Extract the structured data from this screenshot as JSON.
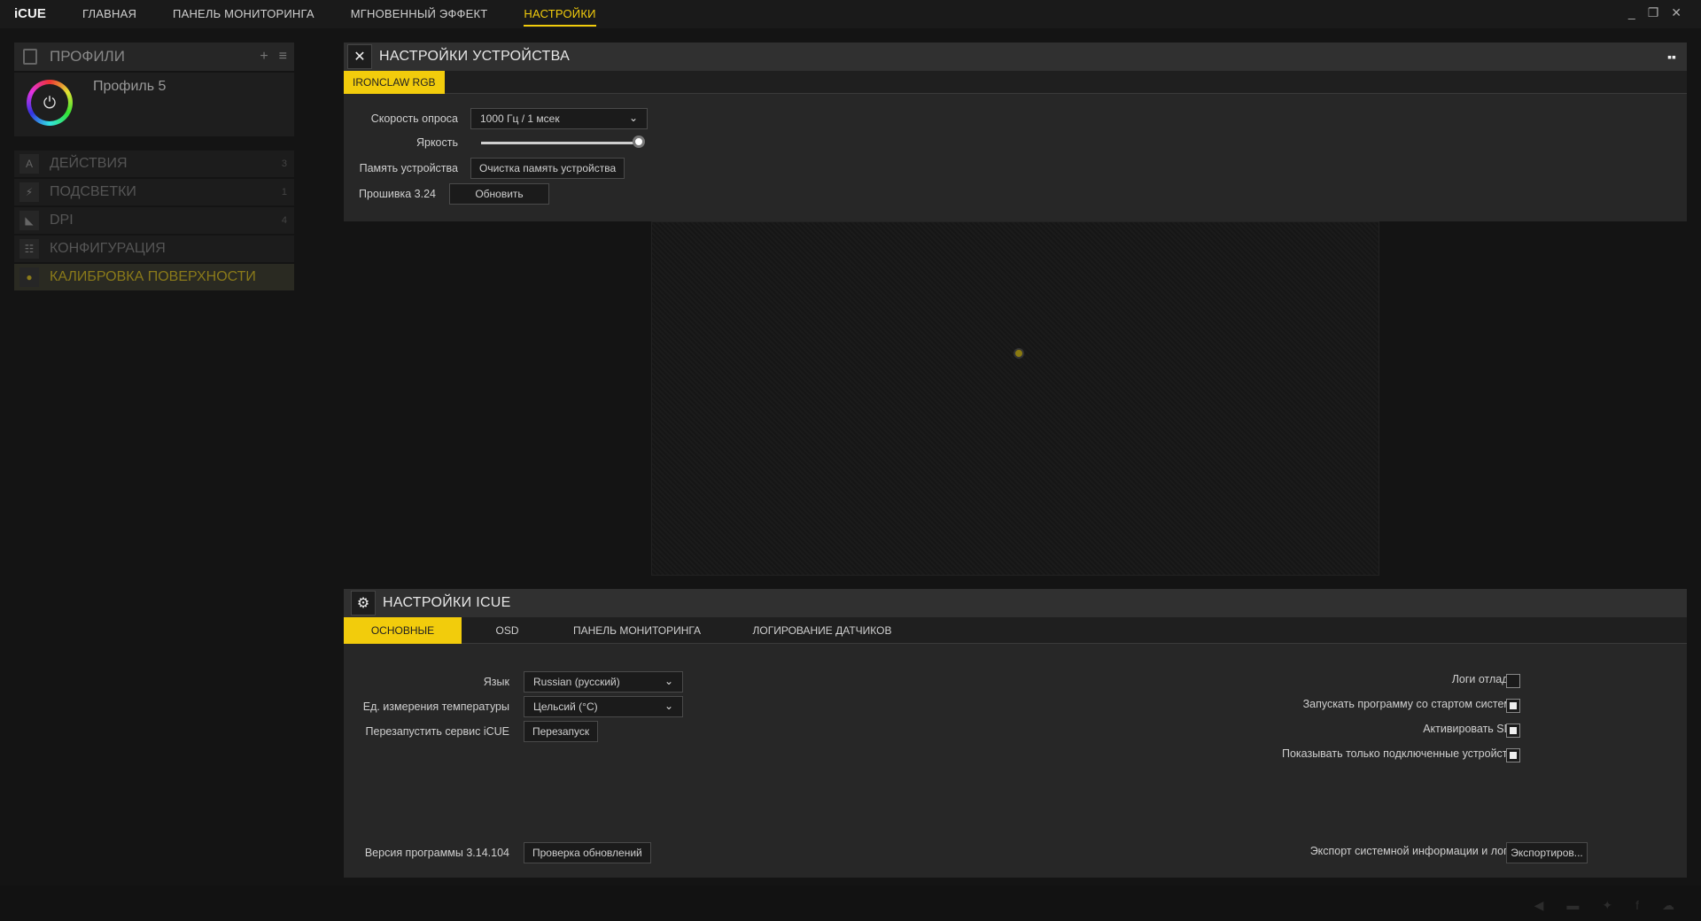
{
  "app": {
    "logo": "iCUE"
  },
  "nav": [
    "ГЛАВНАЯ",
    "ПАНЕЛЬ МОНИТОРИНГА",
    "МГНОВЕННЫЙ ЭФФЕКТ",
    "НАСТРОЙКИ"
  ],
  "sidebar": {
    "profiles_title": "ПРОФИЛИ",
    "profile_name": "Профиль 5",
    "items": [
      {
        "label": "ДЕЙСТВИЯ",
        "count": "3"
      },
      {
        "label": "ПОДСВЕТКИ",
        "count": "1"
      },
      {
        "label": "DPI",
        "count": "4"
      },
      {
        "label": "КОНФИГУРАЦИЯ",
        "count": ""
      },
      {
        "label": "КАЛИБРОВКА ПОВЕРХНОСТИ",
        "count": ""
      }
    ]
  },
  "device": {
    "title": "НАСТРОЙКИ УСТРОЙСТВА",
    "tab": "IRONCLAW RGB",
    "polling_label": "Скорость опроса",
    "polling_value": "1000 Гц / 1 мсек",
    "brightness_label": "Яркость",
    "brightness_level": 1.0,
    "memory_label": "Память устройства",
    "memory_button": "Очистка память устройства",
    "firmware_label": "Прошивка 3.24",
    "update_button": "Обновить"
  },
  "icue": {
    "title": "НАСТРОЙКИ ICUE",
    "tabs": [
      "ОСНОВНЫЕ",
      "OSD",
      "ПАНЕЛЬ МОНИТОРИНГА",
      "ЛОГИРОВАНИЕ ДАТЧИКОВ"
    ],
    "language_label": "Язык",
    "language_value": "Russian (русский)",
    "temp_label": "Ед. измерения температуры",
    "temp_value": "Цельсий (°C)",
    "restart_label": "Перезапустить сервис iCUE",
    "restart_button": "Перезапуск",
    "version_label": "Версия программы 3.14.104",
    "check_updates_button": "Проверка обновлений",
    "debug_logs_label": "Логи отладки",
    "autostart_label": "Запускать программу со стартом системы",
    "sdk_label": "Активировать SDK",
    "connected_only_label": "Показывать только подключенные устройства",
    "export_label": "Экспорт системной информации и логов",
    "export_button": "Экспортиров...",
    "checkbox_states": {
      "debug_logs": false,
      "autostart": true,
      "sdk": true,
      "connected_only": true
    }
  },
  "colors": {
    "accent": "#f2cc0c",
    "panel": "#272727",
    "background": "#141414"
  }
}
